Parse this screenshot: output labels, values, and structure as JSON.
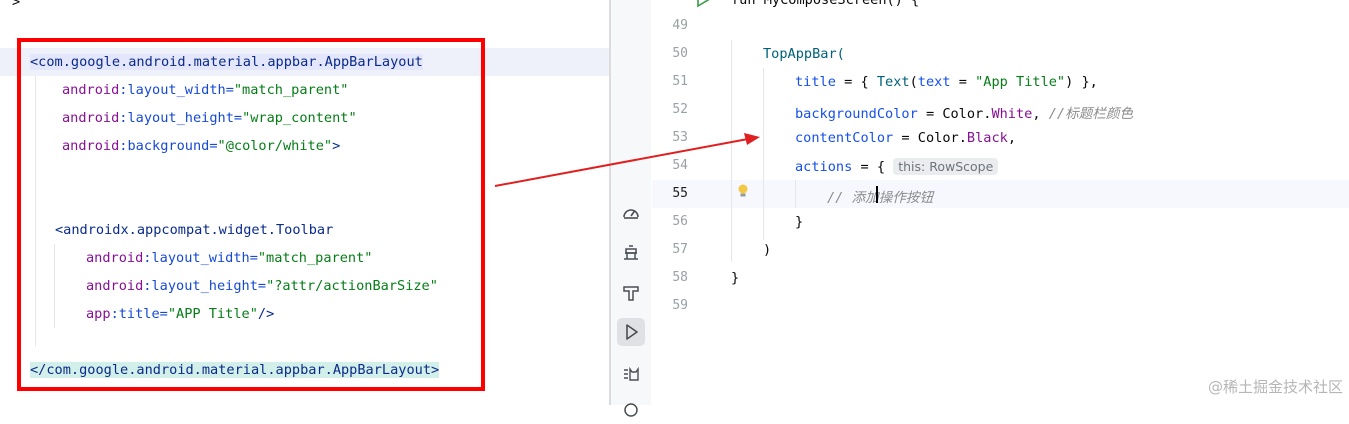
{
  "left_editor": {
    "top_fragment": ">",
    "lines": {
      "appbar_open": "<com.google.android.material.appbar.AppBarLayout",
      "ab_width_ns": "android",
      "ab_width_attr": ":layout_width=",
      "ab_width_val": "\"match_parent\"",
      "ab_height_ns": "android",
      "ab_height_attr": ":layout_height=",
      "ab_height_val": "\"wrap_content\"",
      "ab_bg_ns": "android",
      "ab_bg_attr": ":background=",
      "ab_bg_val": "\"@color/white\"",
      "ab_bg_end": ">",
      "toolbar_open": "<androidx.appcompat.widget.Toolbar",
      "tb_width_ns": "android",
      "tb_width_attr": ":layout_width=",
      "tb_width_val": "\"match_parent\"",
      "tb_height_ns": "android",
      "tb_height_attr": ":layout_height=",
      "tb_height_val": "\"?attr/actionBarSize\"",
      "tb_title_ns": "app",
      "tb_title_attr": ":title=",
      "tb_title_val": "\"APP Title\"",
      "tb_title_end": "/>",
      "appbar_close": "</com.google.android.material.appbar.AppBarLayout>"
    }
  },
  "right_editor": {
    "line_numbers": [
      "49",
      "50",
      "51",
      "52",
      "53",
      "54",
      "55",
      "56",
      "57",
      "58",
      "59"
    ],
    "current_line": "55",
    "top_partial": "fun MyComposeScreen() {",
    "code": {
      "l50": "TopAppBar(",
      "l51_a": "title",
      "l51_b": " = { ",
      "l51_c": "Text",
      "l51_d": "(",
      "l51_e": "text",
      "l51_f": " = ",
      "l51_g": "\"App Title\"",
      "l51_h": ") },",
      "l52_a": "backgroundColor",
      "l52_b": " = Color.",
      "l52_c": "White",
      "l52_d": ", ",
      "l52_e": "//标题栏颜色",
      "l53_a": "contentColor",
      "l53_b": " = Color.",
      "l53_c": "Black",
      "l53_d": ",",
      "l54_a": "actions",
      "l54_b": " = {",
      "l54_hint": "this: RowScope",
      "l55": "// 添加操作按钮",
      "l56": "}",
      "l57": ")",
      "l58": "}"
    }
  },
  "tools": [
    "profiler-icon",
    "bug-icon",
    "build-hammer-icon",
    "run-icon",
    "logcat-icon"
  ],
  "watermark": "@稀土掘金技术社区",
  "colors": {
    "highlight_box": "#ff0000",
    "arrow": "#e02020"
  }
}
